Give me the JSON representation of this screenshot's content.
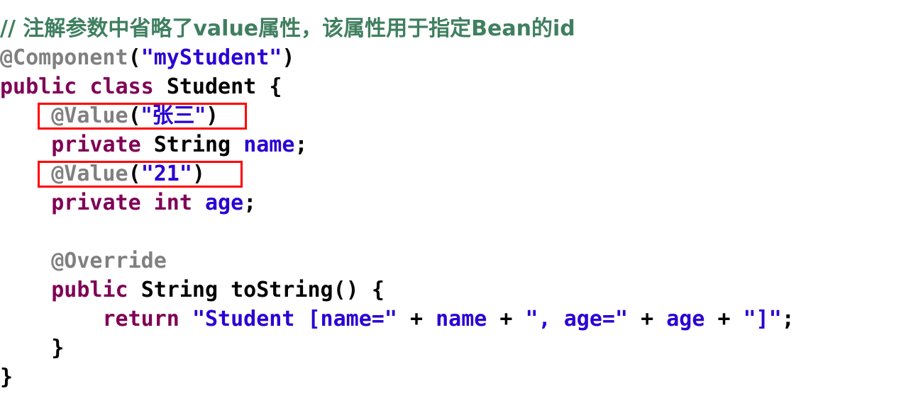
{
  "editor": {
    "background_color": "#ffffff",
    "language": "java",
    "font_weight": "bold",
    "line_height_px": 41
  },
  "palette": {
    "comment": "#3f7f5f",
    "annotation": "#808080",
    "keyword": "#7f0055",
    "string": "#2a00d4",
    "identifier": "#2a00d4",
    "plain": "#000000",
    "highlight_box": "#ff0000"
  },
  "code": {
    "line1": {
      "comment": "// 注解参数中省略了value属性，该属性用于指定Bean的id"
    },
    "line2": {
      "annotation": "@Component",
      "paren_open": "(",
      "string": "\"myStudent\"",
      "paren_close": ")"
    },
    "line3": {
      "keyword_public": "public",
      "space1": " ",
      "keyword_class": "class",
      "space2": " ",
      "type_name": "Student",
      "space3": " ",
      "brace_open": "{"
    },
    "line4": {
      "indent": "    ",
      "annotation": "@Value",
      "paren_open": "(",
      "string": "\"张三\"",
      "paren_close": ")"
    },
    "line5": {
      "indent": "    ",
      "keyword_private": "private",
      "space1": " ",
      "type_name": "String",
      "space2": " ",
      "field_name": "name",
      "semicolon": ";"
    },
    "line6": {
      "indent": "    ",
      "annotation": "@Value",
      "paren_open": "(",
      "string": "\"21\"",
      "paren_close": ")"
    },
    "line7": {
      "indent": "    ",
      "keyword_private": "private",
      "space1": " ",
      "keyword_int": "int",
      "space2": " ",
      "field_name": "age",
      "semicolon": ";"
    },
    "line8": {
      "blank": " "
    },
    "line9": {
      "indent": "    ",
      "annotation": "@Override"
    },
    "line10": {
      "indent": "    ",
      "keyword_public": "public",
      "space1": " ",
      "return_type": "String",
      "space2": " ",
      "method_name": "toString()",
      "space3": " ",
      "brace_open": "{"
    },
    "line11": {
      "indent": "        ",
      "keyword_return": "return",
      "space1": " ",
      "string1": "\"Student [name=\"",
      "op1": " + ",
      "ident1": "name",
      "op2": " + ",
      "string2": "\", age=\"",
      "op3": " + ",
      "ident2": "age",
      "op4": " + ",
      "string3": "\"]\"",
      "semicolon": ";"
    },
    "line12": {
      "indent": "    ",
      "brace_close": "}"
    },
    "line13": {
      "brace_close": "}"
    }
  },
  "annotations": {
    "boxes": [
      {
        "label": "value-annotation-name-highlight",
        "target": "@Value(\"张三\")"
      },
      {
        "label": "value-annotation-age-highlight",
        "target": "@Value(\"21\")"
      }
    ]
  }
}
